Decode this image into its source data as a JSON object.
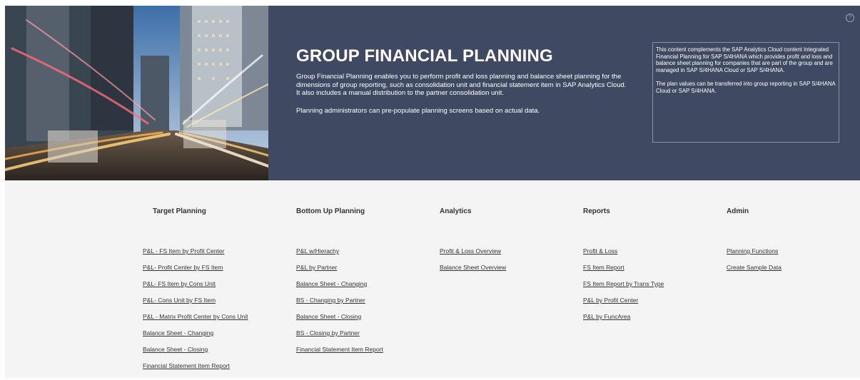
{
  "header": {
    "title": "GROUP FINANCIAL PLANNING",
    "description": "Group Financial Planning enables you to perform profit and loss planning and balance sheet planning for the dimensions of group reporting, such as consolidation unit and financial statement item in SAP Analytics Cloud.  It also includes a manual distribution to the partner consolidation unit.",
    "description2": "Planning administrators can pre-populate planning screens based on actual data.",
    "note_p1": "This content complements the SAP Analytics Cloud content Integrated Financial Planning for SAP S/4HANA which provides profit and loss and balance sheet planning for companies that are part of the group and are managed in SAP S/4HANA Cloud or SAP S/4HANA.",
    "note_p2": "The plan values can be transferred into group reporting in SAP S/4HANA Cloud or SAP S/4HANA.",
    "help_icon": "?"
  },
  "columns": [
    {
      "title": "Target Planning",
      "links": [
        "P&L - FS Item by Profit Center",
        "P&L- Profit Center by FS Item",
        "P&L- FS Item by Cons Unit",
        "P&L- Cons Unit by FS Item",
        "P&L - Matrix Profit Center by Cons Unit",
        "Balance Sheet - Changing",
        "Balance Sheet - Closing",
        "Financial Statement Item Report"
      ]
    },
    {
      "title": "Bottom Up Planning",
      "links": [
        "P&L w/Hierachy",
        "P&L by Partner",
        "Balance Sheet - Changing",
        "BS - Changing by Partner",
        "Balance Sheet - Closing",
        "BS - Closing by Partner",
        "Financial Statement Item Report"
      ]
    },
    {
      "title": "Analytics",
      "links": [
        "Profit & Loss Overview",
        "Balance Sheet Overview"
      ]
    },
    {
      "title": "Reports",
      "links": [
        "Profit & Loss",
        "FS Item Report",
        "FS Item Report by Trans Type",
        "P&L by Profit Center",
        "P&L by FuncArea"
      ]
    },
    {
      "title": "Admin",
      "links": [
        "Planning Functions",
        "Create Sample Data"
      ]
    }
  ]
}
